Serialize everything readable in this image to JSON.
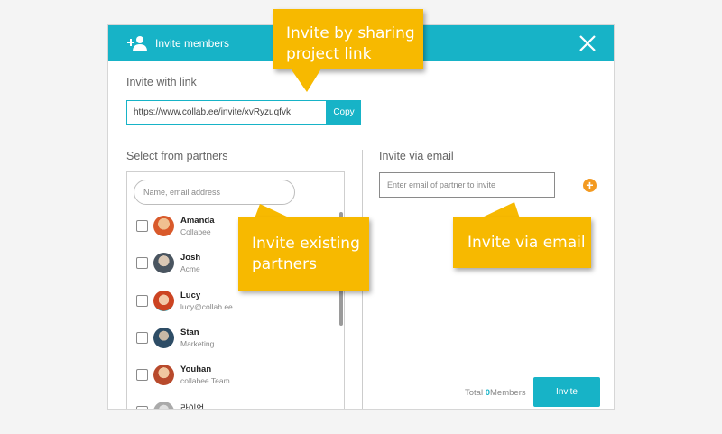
{
  "header": {
    "title": "Invite members",
    "icon": "add-person-icon"
  },
  "invite_link": {
    "label": "Invite with link",
    "url": "https://www.collab.ee/invite/xvRyzuqfvk",
    "copy_label": "Copy"
  },
  "partners": {
    "label": "Select from partners",
    "search_placeholder": "Name, email address",
    "items": [
      {
        "name": "Amanda",
        "subtitle": "Collabee",
        "avatar_color": "#d95a2b"
      },
      {
        "name": "Josh",
        "subtitle": "Acme",
        "avatar_color": "#4a5560"
      },
      {
        "name": "Lucy",
        "subtitle": "lucy@collab.ee",
        "avatar_color": "#cc4422"
      },
      {
        "name": "Stan",
        "subtitle": "Marketing",
        "avatar_color": "#2e4d66"
      },
      {
        "name": "Youhan",
        "subtitle": "collabee Team",
        "avatar_color": "#b84a2c"
      },
      {
        "name": "라이언",
        "subtitle": "",
        "avatar_color": "#aaaaaa"
      }
    ]
  },
  "email_invite": {
    "label": "Invite via email",
    "placeholder": "Enter email of partner to invite",
    "add_label": "+"
  },
  "footer": {
    "total_prefix": "Total ",
    "total_count": "0",
    "total_suffix": "Members",
    "invite_label": "Invite"
  },
  "callouts": {
    "share_link": "Invite by sharing project link",
    "existing": "Invite existing partners",
    "email": "Invite via email"
  },
  "colors": {
    "accent": "#17b3c7",
    "callout": "#f7b900",
    "add_button": "#f39a21"
  }
}
